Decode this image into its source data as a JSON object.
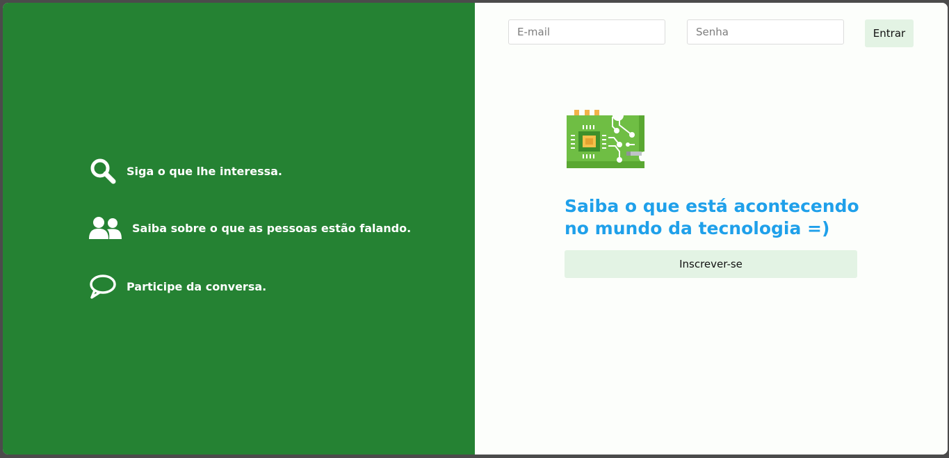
{
  "features": [
    {
      "icon": "search-icon",
      "text": "Siga o que lhe interessa."
    },
    {
      "icon": "users-icon",
      "text": "Saiba sobre o que as pessoas estão falando."
    },
    {
      "icon": "chat-bubble-icon",
      "text": "Participe da conversa."
    }
  ],
  "login": {
    "email_placeholder": "E-mail",
    "email_value": "",
    "password_placeholder": "Senha",
    "password_value": "",
    "submit_label": "Entrar"
  },
  "hero": {
    "logo_icon": "circuit-board-icon",
    "headline": "Saiba o que está acontecendo no mundo da tecnologia =)",
    "signup_label": "Inscrever-se"
  },
  "colors": {
    "left_panel": "#258233",
    "right_panel": "#fcfefb",
    "headline": "#1fa0ea",
    "button_bg": "#e3f3e4"
  }
}
